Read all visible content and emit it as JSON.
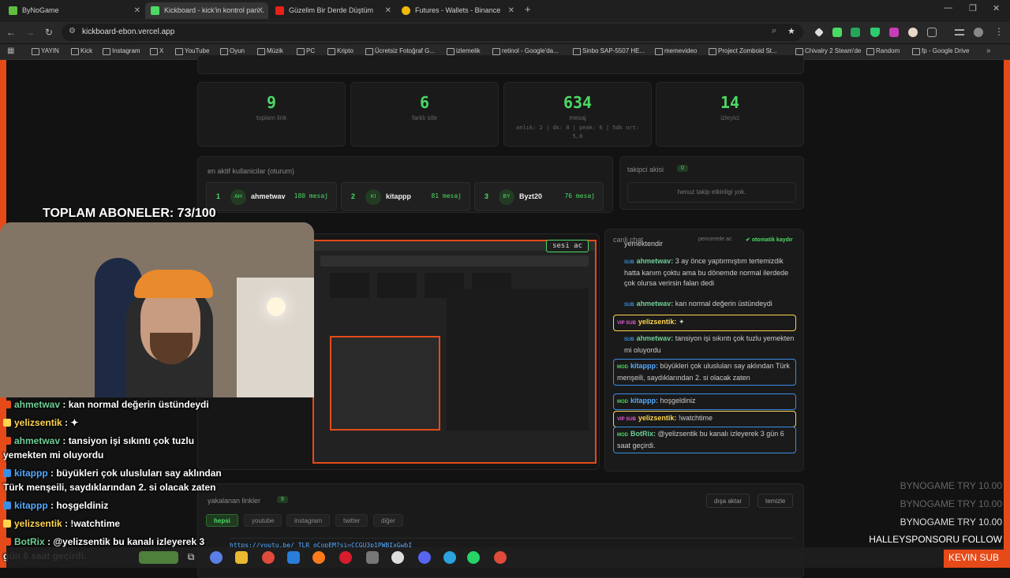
{
  "browser": {
    "tabs": [
      {
        "label": "ByNoGame",
        "active": false
      },
      {
        "label": "Kickboard - kick'in kontrol pan...",
        "active": true
      },
      {
        "label": "Güzelim Bir Derde Düştüm",
        "active": false
      },
      {
        "label": "Futures - Wallets - Binance",
        "active": false
      }
    ],
    "url": "kickboard-ebon.vercel.app",
    "bookmarks": [
      "YAYIN",
      "Kick",
      "Instagram",
      "X",
      "YouTube",
      "Oyun",
      "Müzik",
      "PC",
      "Kripto",
      "Ücretsiz Fotoğraf G...",
      "izlemelik",
      "retinol - Google'da...",
      "Sinbo SAP-5507 HE...",
      "memevideo",
      "Project Zomboid St...",
      "Chivalry 2 Steam'de",
      "Random",
      "fp - Google Drive"
    ]
  },
  "stats": [
    {
      "value": "9",
      "label": "toplam link",
      "sub": ""
    },
    {
      "value": "6",
      "label": "farklı site",
      "sub": ""
    },
    {
      "value": "634",
      "label": "mesaj",
      "sub": "anlık: 2 | dk: 8 | peak: 6 | 5dk ort: 5,0"
    },
    {
      "value": "14",
      "label": "izleyici",
      "sub": ""
    }
  ],
  "top_users": {
    "title": "en aktif kullanicilar (oturum)",
    "items": [
      {
        "rank": "1",
        "initials": "AH",
        "name": "ahmetwav",
        "count": "180 mesaj"
      },
      {
        "rank": "2",
        "initials": "KI",
        "name": "kitappp",
        "count": "81 mesaj"
      },
      {
        "rank": "3",
        "initials": "BY",
        "name": "Byzt20",
        "count": "76 mesaj"
      }
    ]
  },
  "follow_feed": {
    "title": "takipci akisi",
    "count": "0",
    "empty": "henuz takip etkinligi yok."
  },
  "live_chat": {
    "title": "canli chat",
    "popout": "pencerede ac",
    "autoscroll": "otomatik kaydır",
    "messages": [
      {
        "badges": "",
        "user": "",
        "text": "yemektendir",
        "style": "plain",
        "color": "green"
      },
      {
        "badges": "SUB",
        "user": "ahmetwav:",
        "text": "3 ay önce yaptırmıştım tertemizdik hatta kanım çoktu ama bu dönemde normal ilerdede çok olursa verirsin falan dedi",
        "style": "plain",
        "color": "green"
      },
      {
        "badges": "SUB",
        "user": "ahmetwav:",
        "text": "kan normal değerin üstündeydi",
        "style": "plain",
        "color": "green"
      },
      {
        "badges": "VIP SUB",
        "user": "yelizsentik:",
        "text": "✦",
        "style": "vip",
        "color": "yellow"
      },
      {
        "badges": "SUB",
        "user": "ahmetwav:",
        "text": "tansiyon işi sıkıntı çok tuzlu yemekten mi oluyordu",
        "style": "plain",
        "color": "green"
      },
      {
        "badges": "MOD",
        "user": "kitappp:",
        "text": "büyükleri çok ulusluları say aklından Türk menşeili, saydıklarından 2. si olacak zaten",
        "style": "mod",
        "color": "blue"
      },
      {
        "badges": "MOD",
        "user": "kitappp:",
        "text": "hoşgeldiniz",
        "style": "mod",
        "color": "blue"
      },
      {
        "badges": "VIP SUB",
        "user": "yelizsentik:",
        "text": "!watchtime",
        "style": "vip",
        "color": "yellow"
      },
      {
        "badges": "MOD",
        "user": "BotRix:",
        "text": "@yelizsentik bu kanalı izleyerek 3 gün 6 saat geçirdi.",
        "style": "mod",
        "color": "green"
      }
    ]
  },
  "preview_label": "sesi ac",
  "links": {
    "title": "yakalanan linkler",
    "count": "9",
    "export": "dışa aktar",
    "clear": "temizle",
    "filters": [
      "hepsi",
      "youtube",
      "instagram",
      "twitter",
      "diğer"
    ],
    "first_link": "https://youtu.be/_TLR_oCopEM?si=CCGU3p1PWBIxGwbI"
  },
  "overlay": {
    "subs": "TOPLAM ABONELER: 73/100",
    "chat": [
      {
        "user": "ahmetwav",
        "text": ": kan normal değerin üstündeydi",
        "cls": "u1"
      },
      {
        "user": "yelizsentik",
        "text": ": ✦",
        "cls": "u3"
      },
      {
        "user": "ahmetwav",
        "text": ": tansiyon işi sıkıntı çok tuzlu",
        "cls": "u1",
        "cont": "yemekten mi oluyordu"
      },
      {
        "user": "kitappp",
        "text": ": büyükleri çok ulusluları say aklından",
        "cls": "u2",
        "cont": "Türk menşeili, saydıklarından 2. si olacak zaten"
      },
      {
        "user": "kitappp",
        "text": ": hoşgeldiniz",
        "cls": "u2"
      },
      {
        "user": "yelizsentik",
        "text": ": !watchtime",
        "cls": "u3"
      },
      {
        "user": "BotRix",
        "text": ": @yelizsentik bu kanalı izleyerek 3",
        "cls": "u1",
        "cont": "gün 6 saat geçirdi."
      }
    ],
    "side": [
      "BYNOGAME  TRY 10.00",
      "BYNOGAME  TRY 10.00",
      "BYNOGAME  TRY 10.00",
      "HALLEYSPONSORU  FOLLOW",
      "KEVIN  SUB"
    ]
  },
  "colors": {
    "accent": "#4cd964",
    "border": "#e64a19",
    "mod": "#3a8ee6",
    "vip": "#ffd54f"
  }
}
